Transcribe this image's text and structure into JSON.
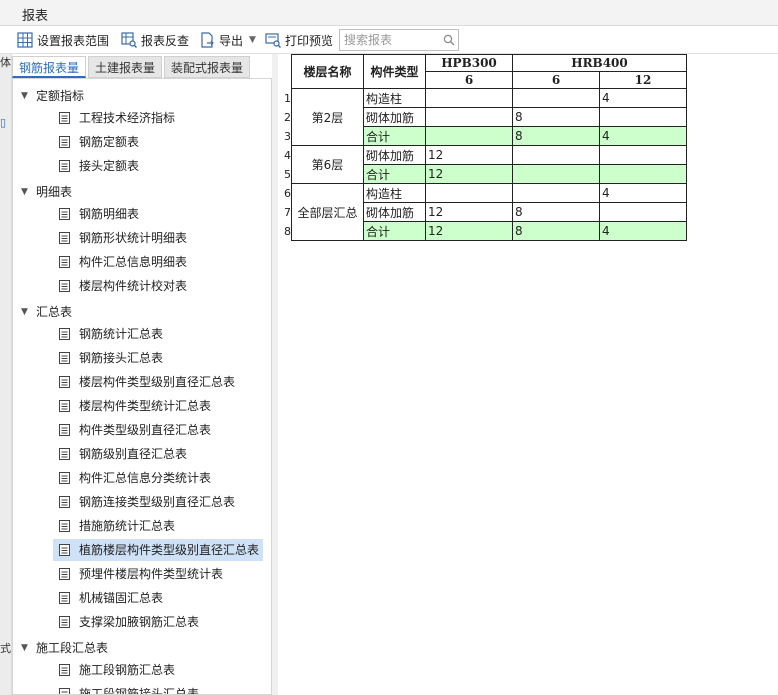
{
  "window": {
    "title": "报表"
  },
  "toolbar": {
    "set_range": "设置报表范围",
    "reverse_check": "报表反查",
    "export": "导出",
    "print_preview": "打印预览",
    "search_placeholder": "搜索报表"
  },
  "left_strip": {
    "frag1": "体",
    "frag2": "式"
  },
  "tabs": [
    "钢筋报表量",
    "土建报表量",
    "装配式报表量"
  ],
  "tree": {
    "groups": [
      {
        "label": "定额指标",
        "items": [
          "工程技术经济指标",
          "钢筋定额表",
          "接头定额表"
        ]
      },
      {
        "label": "明细表",
        "items": [
          "钢筋明细表",
          "钢筋形状统计明细表",
          "构件汇总信息明细表",
          "楼层构件统计校对表"
        ]
      },
      {
        "label": "汇总表",
        "items": [
          "钢筋统计汇总表",
          "钢筋接头汇总表",
          "楼层构件类型级别直径汇总表",
          "楼层构件类型统计汇总表",
          "构件类型级别直径汇总表",
          "钢筋级别直径汇总表",
          "构件汇总信息分类统计表",
          "钢筋连接类型级别直径汇总表",
          "措施筋统计汇总表",
          "植筋楼层构件类型级别直径汇总表",
          "预埋件楼层构件类型统计表",
          "机械锚固汇总表",
          "支撑梁加腋钢筋汇总表"
        ]
      },
      {
        "label": "施工段汇总表",
        "items": [
          "施工段钢筋汇总表",
          "施工段钢筋接头汇总表"
        ]
      }
    ],
    "selected": "植筋楼层构件类型级别直径汇总表"
  },
  "report": {
    "headers": {
      "floor": "楼层名称",
      "type": "构件类型",
      "grade1": "HPB300",
      "grade2": "HRB400",
      "d1": "6",
      "d2": "6",
      "d3": "12"
    },
    "rows": [
      {
        "rn": "1",
        "floor": "第2层",
        "type": "构造柱",
        "v1": "",
        "v2": "",
        "v3": "4"
      },
      {
        "rn": "2",
        "floor": "",
        "type": "砌体加筋",
        "v1": "",
        "v2": "8",
        "v3": ""
      },
      {
        "rn": "3",
        "floor": "",
        "type": "合计",
        "v1": "",
        "v2": "8",
        "v3": "4"
      },
      {
        "rn": "4",
        "floor": "第6层",
        "type": "砌体加筋",
        "v1": "12",
        "v2": "",
        "v3": ""
      },
      {
        "rn": "5",
        "floor": "",
        "type": "合计",
        "v1": "12",
        "v2": "",
        "v3": ""
      },
      {
        "rn": "6",
        "floor": "全部层汇总",
        "type": "构造柱",
        "v1": "",
        "v2": "",
        "v3": "4"
      },
      {
        "rn": "7",
        "floor": "",
        "type": "砌体加筋",
        "v1": "12",
        "v2": "8",
        "v3": ""
      },
      {
        "rn": "8",
        "floor": "",
        "type": "合计",
        "v1": "12",
        "v2": "8",
        "v3": "4"
      }
    ]
  },
  "colors": {
    "accent": "#2b6cc4",
    "total_row": "#ccffcc",
    "selected": "#cfe1f6"
  }
}
